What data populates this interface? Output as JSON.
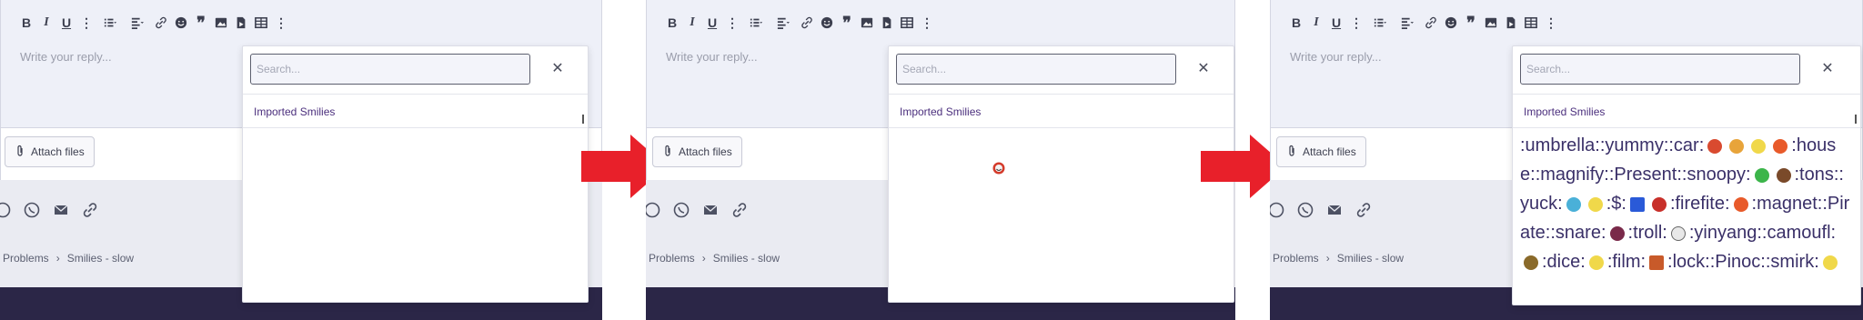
{
  "panels": [
    {
      "toolbar": {
        "bold": "B",
        "italic": "I",
        "underline": "U",
        "more": "⋮"
      },
      "editor": {
        "placeholder": "Write your reply..."
      },
      "attach_label": "Attach files",
      "breadcrumbs": [
        "Problems",
        "Smilies - slow"
      ],
      "popup": {
        "search_placeholder": "Search...",
        "category": "Imported Smilies",
        "close": "✕"
      }
    },
    {
      "toolbar": {
        "bold": "B",
        "italic": "I",
        "underline": "U",
        "more": "⋮"
      },
      "editor": {
        "placeholder": "Write your reply..."
      },
      "attach_label": "Attach files",
      "breadcrumbs": [
        "Problems",
        "Smilies - slow"
      ],
      "popup": {
        "search_placeholder": "Search...",
        "category": "Imported Smilies",
        "close": "✕"
      }
    },
    {
      "toolbar": {
        "bold": "B",
        "italic": "I",
        "underline": "U",
        "more": "⋮"
      },
      "editor": {
        "placeholder": "Write your reply..."
      },
      "attach_label": "Attach files",
      "breadcrumbs": [
        "Problems",
        "Smilies - slow"
      ],
      "popup": {
        "search_placeholder": "Search...",
        "category": "Imported Smilies",
        "close": "✕"
      }
    }
  ],
  "smilies_text": [
    ":umbrella:",
    ":yummy:",
    ":car:",
    ":house:",
    ":magnify:",
    ":Present:",
    ":snoopy:",
    ":tons:",
    ":yuck:",
    ":$:",
    ":firefite:",
    ":magnet:",
    ":Pirate:",
    ":snare:",
    ":troll:",
    ":yinyang:",
    ":camoufl:",
    ":dice:",
    ":film:",
    ":lock:",
    ":Pinoc:",
    ":smirk:"
  ],
  "colors": {
    "arrow": "#e8202a",
    "accent": "#4b2f7d",
    "footer": "#2b2647"
  }
}
